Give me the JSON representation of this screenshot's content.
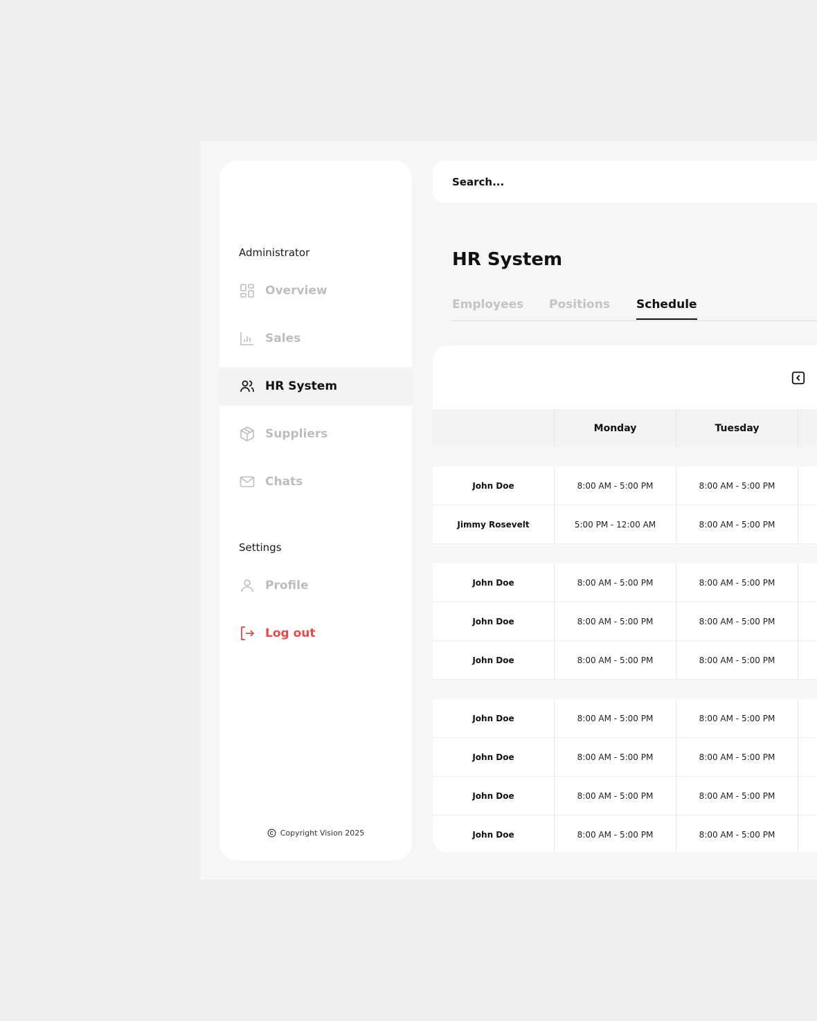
{
  "sidebar": {
    "section_admin": "Administrator",
    "section_settings": "Settings",
    "items": [
      {
        "label": "Overview",
        "icon": "grid-icon"
      },
      {
        "label": "Sales",
        "icon": "bar-chart-icon"
      },
      {
        "label": "HR System",
        "icon": "users-icon"
      },
      {
        "label": "Suppliers",
        "icon": "box-icon"
      },
      {
        "label": "Chats",
        "icon": "mail-icon"
      }
    ],
    "profile": "Profile",
    "logout": "Log out",
    "copyright": "Copyright Vision 2025"
  },
  "search": {
    "placeholder": "Search..."
  },
  "page": {
    "title": "HR System"
  },
  "tabs": [
    {
      "label": "Employees",
      "active": false
    },
    {
      "label": "Positions",
      "active": false
    },
    {
      "label": "Schedule",
      "active": true
    }
  ],
  "schedule": {
    "columns": [
      "",
      "Monday",
      "Tuesday"
    ],
    "groups": [
      [
        [
          "John Doe",
          "8:00 AM - 5:00 PM",
          "8:00 AM - 5:00 PM"
        ],
        [
          "Jimmy Rosevelt",
          "5:00 PM - 12:00 AM",
          "8:00 AM - 5:00 PM"
        ]
      ],
      [
        [
          "John Doe",
          "8:00 AM - 5:00 PM",
          "8:00 AM - 5:00 PM"
        ],
        [
          "John Doe",
          "8:00 AM - 5:00 PM",
          "8:00 AM - 5:00 PM"
        ],
        [
          "John Doe",
          "8:00 AM - 5:00 PM",
          "8:00 AM - 5:00 PM"
        ]
      ],
      [
        [
          "John Doe",
          "8:00 AM - 5:00 PM",
          "8:00 AM - 5:00 PM"
        ],
        [
          "John Doe",
          "8:00 AM - 5:00 PM",
          "8:00 AM - 5:00 PM"
        ],
        [
          "John Doe",
          "8:00 AM - 5:00 PM",
          "8:00 AM - 5:00 PM"
        ],
        [
          "John Doe",
          "8:00 AM - 5:00 PM",
          "8:00 AM - 5:00 PM"
        ]
      ]
    ]
  },
  "colors": {
    "accent": "#111111",
    "logout": "#e04b4b",
    "muted": "#bdbdbd"
  }
}
